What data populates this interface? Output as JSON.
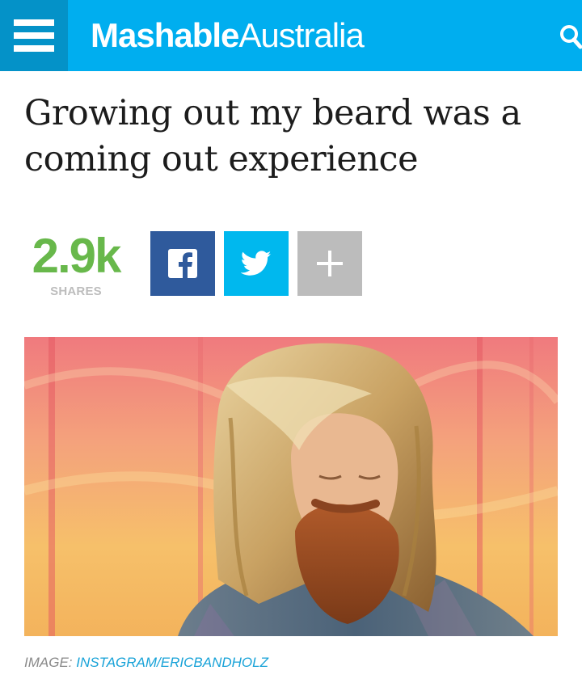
{
  "header": {
    "logo_bold": "Mashable",
    "logo_light": "Australia",
    "menu_icon": "hamburger-menu-icon",
    "search_icon": "search-icon",
    "brand_color": "#00aeef",
    "menu_bg_color": "#0492c8"
  },
  "article": {
    "headline": "Growing out my beard was a coming out experience"
  },
  "shares": {
    "count": "2.9k",
    "label": "SHARES",
    "count_color": "#68b84b",
    "buttons": [
      {
        "network": "facebook",
        "icon": "facebook-icon",
        "color": "#2f5a9c"
      },
      {
        "network": "twitter",
        "icon": "twitter-bird-icon",
        "color": "#00b8ee"
      },
      {
        "network": "more",
        "icon": "plus-icon",
        "symbol": "+",
        "color": "#bcbcbc"
      }
    ]
  },
  "image": {
    "caption_prefix": "IMAGE:",
    "credit": "INSTAGRAM/ERICBANDHOLZ",
    "credit_color": "#19a3d8"
  }
}
